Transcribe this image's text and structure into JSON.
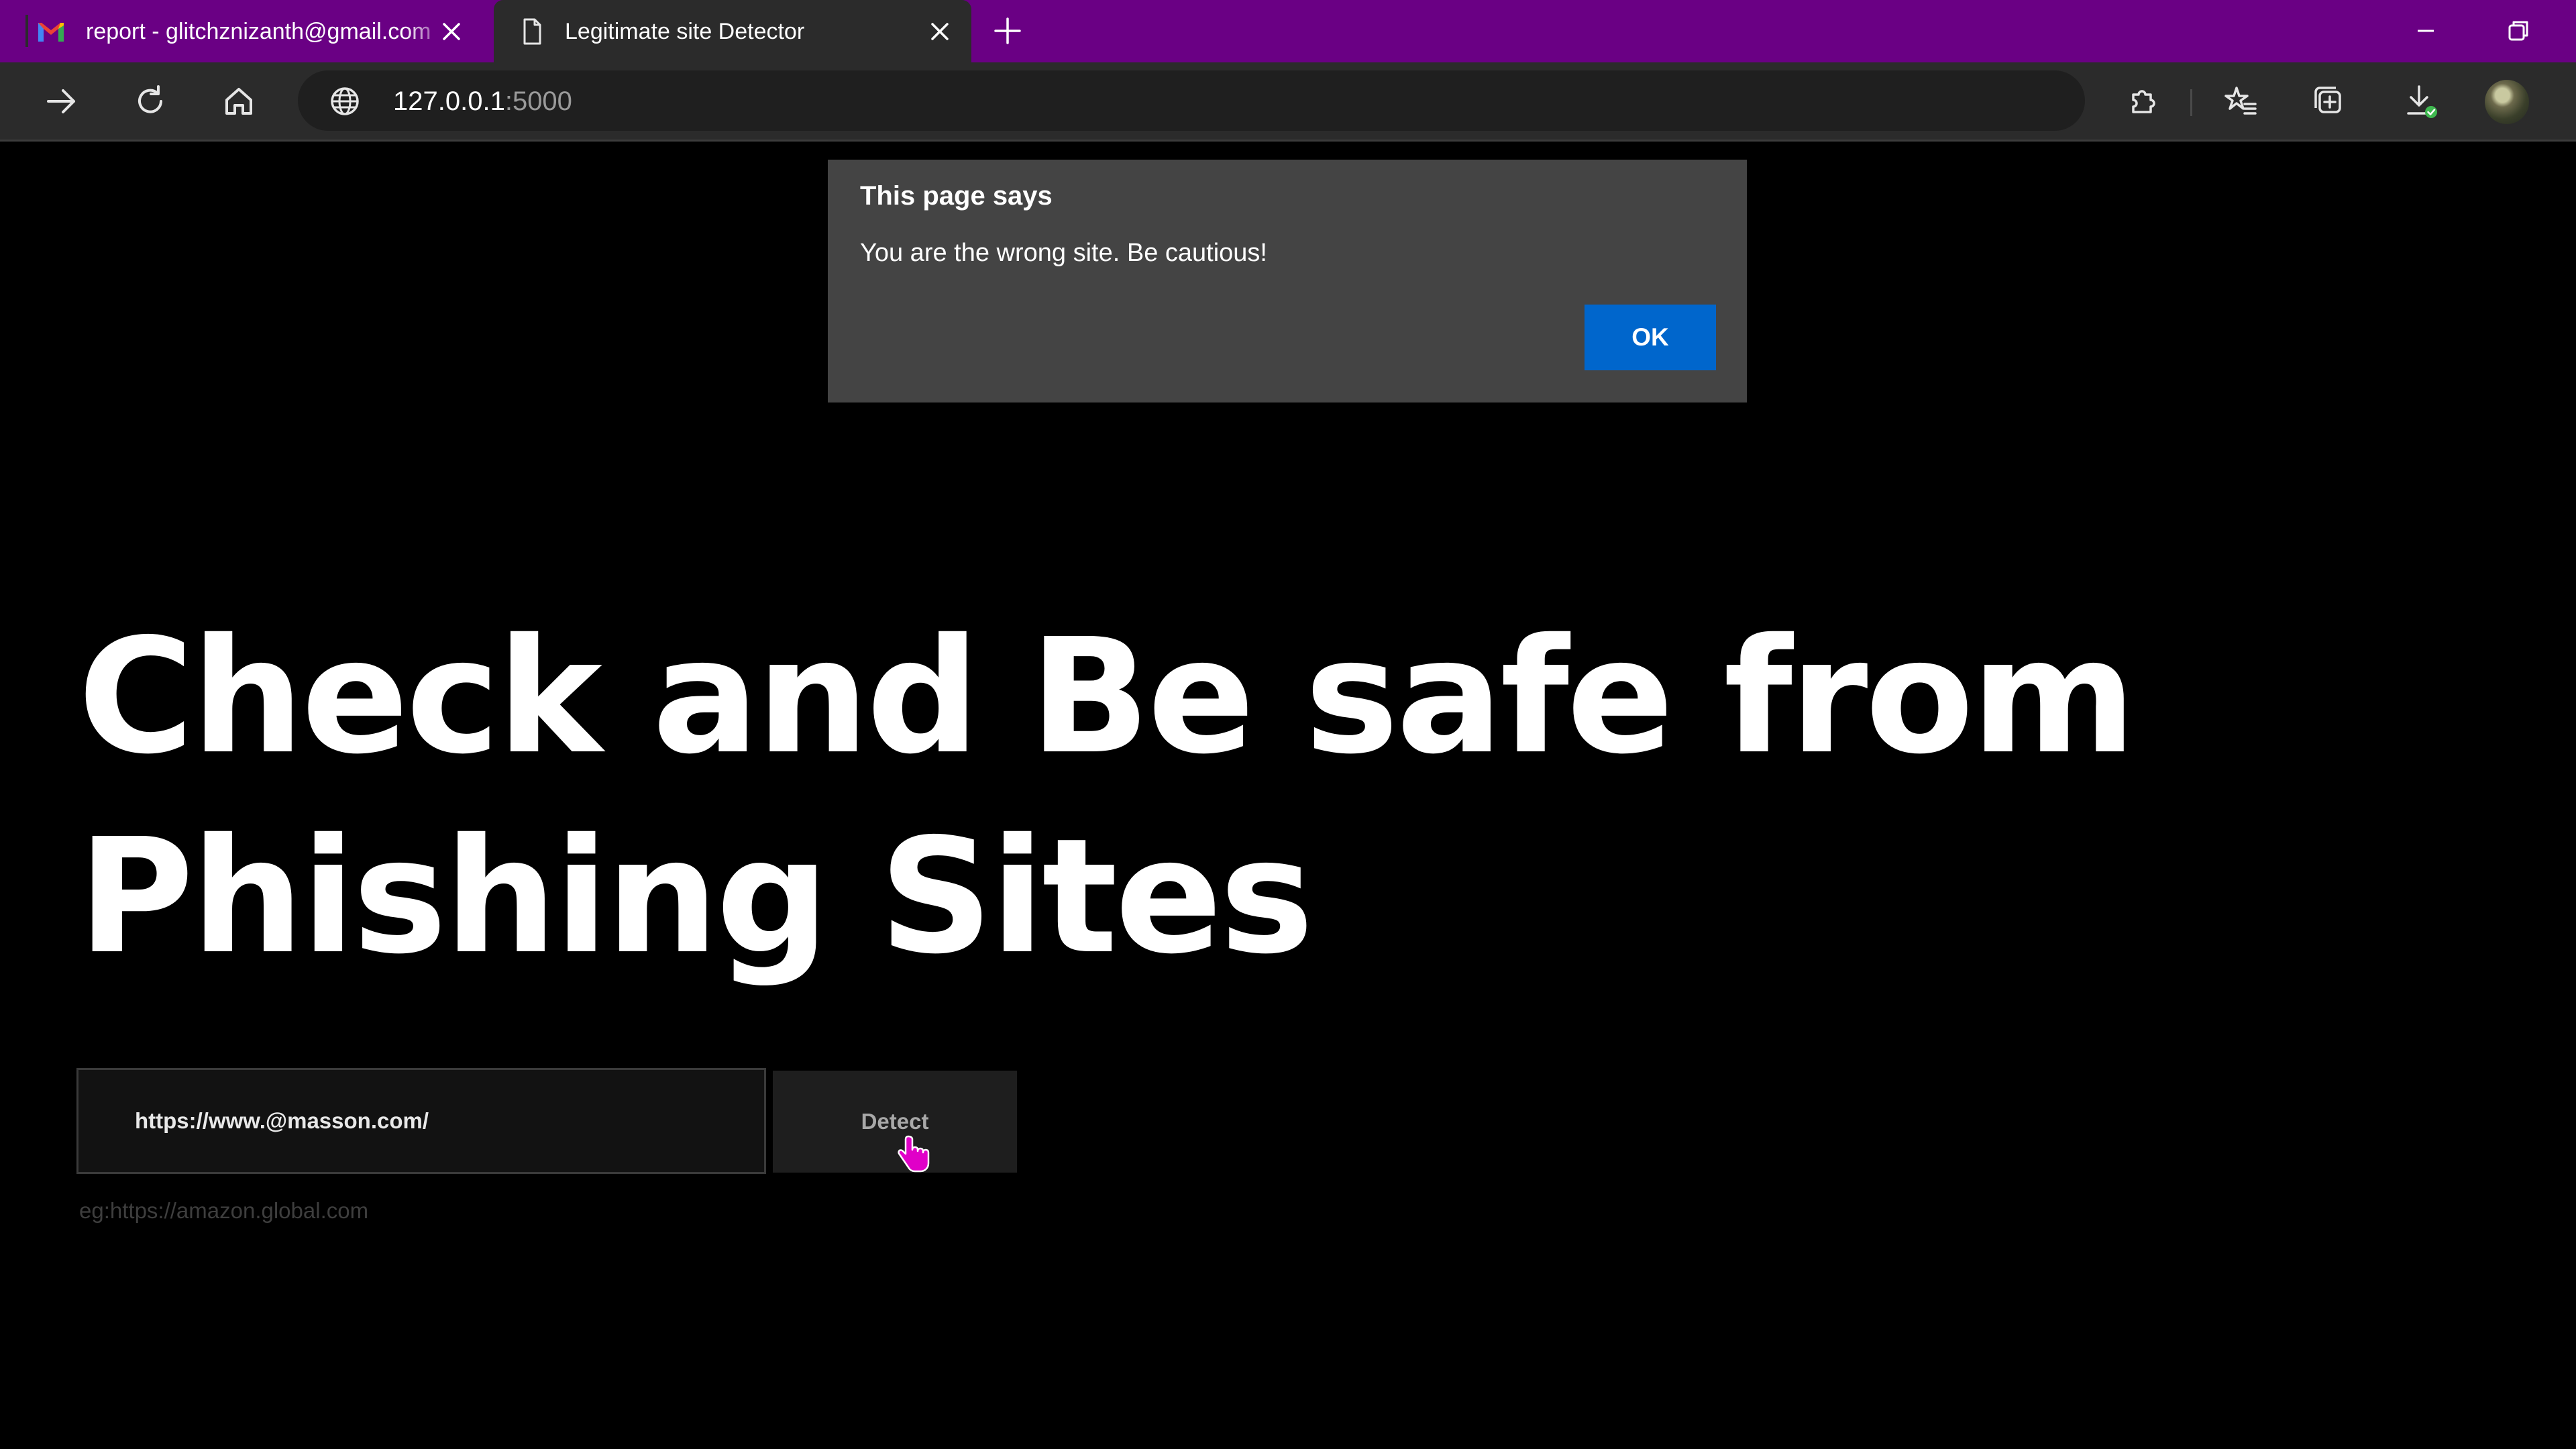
{
  "browser": {
    "tabs": [
      {
        "title": "report - glitchznizanth@gmail.com",
        "icon": "gmail-icon",
        "active": false
      },
      {
        "title": "Legitimate site Detector",
        "icon": "page-icon",
        "active": true
      }
    ],
    "address": {
      "host": "127.0.0.1",
      "port": ":5000"
    },
    "colors": {
      "tabstrip": "#6a0084",
      "toolbar": "#2b2b2b"
    }
  },
  "page": {
    "headline_line1": "Check and Be safe from",
    "headline_line2": "Phishing Sites",
    "url_input_value": "https://www.@masson.com/",
    "detect_label": "Detect",
    "hint": "eg:https://amazon.global.com"
  },
  "dialog": {
    "title": "This page says",
    "message": "You are the wrong site. Be cautious!",
    "ok_label": "OK",
    "ok_color": "#0066cc"
  }
}
